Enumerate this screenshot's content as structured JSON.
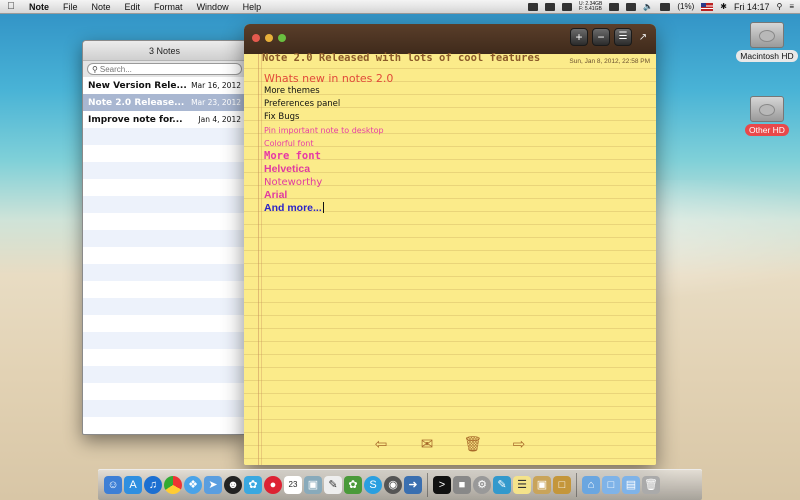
{
  "menubar": {
    "app_name": "Note",
    "menus": [
      "File",
      "Note",
      "Edit",
      "Format",
      "Window",
      "Help"
    ],
    "memory_used": "2.34GB",
    "memory_free": "5.41GB",
    "memory_used_prefix": "U:",
    "memory_free_prefix": "F:",
    "battery": "(1%)",
    "clock": "Fri 14:17"
  },
  "notes_list": {
    "title": "3 Notes",
    "search_placeholder": "Search...",
    "items": [
      {
        "title": "New Version Rele...",
        "date": "Mar 16, 2012"
      },
      {
        "title": "Note 2.0 Release...",
        "date": "Mar 23, 2012",
        "selected": true
      },
      {
        "title": "Improve note for...",
        "date": "Jan 4, 2012"
      }
    ]
  },
  "note": {
    "title": "Note 2.0 Released with lots of cool features",
    "date": "Sun, Jan 8, 2012, 22:58 PM",
    "lines": [
      {
        "text": "Whats new in notes 2.0",
        "style": "head"
      },
      {
        "text": "More themes",
        "style": "black"
      },
      {
        "text": "Preferences panel",
        "style": "black"
      },
      {
        "text": "Fix Bugs",
        "style": "black"
      },
      {
        "text": "Pin important note to desktop",
        "style": "pink-small"
      },
      {
        "text": "Colorful font",
        "style": "pink-small"
      },
      {
        "text": "More font",
        "style": "pink-mono"
      },
      {
        "text": "Helvetica",
        "style": "pink-bold"
      },
      {
        "text": "Noteworthy",
        "style": "pink-reg"
      },
      {
        "text": "Arial",
        "style": "pink-bold"
      },
      {
        "text": "And more...",
        "style": "blue"
      }
    ],
    "toolbar_icons": [
      "add-note-icon",
      "delete-note-icon",
      "list-icon",
      "expand-icon"
    ],
    "bottom_icons": [
      "previous-icon",
      "mail-icon",
      "trash-icon",
      "next-icon"
    ]
  },
  "desktop": {
    "disks": [
      {
        "label": "Macintosh HD"
      },
      {
        "label": "Other HD"
      }
    ]
  },
  "dock": {
    "icons": [
      "finder-icon",
      "app-store-icon",
      "itunes-icon",
      "chrome-icon",
      "safari-icon",
      "mail-send-icon",
      "qq-icon",
      "twitter-icon",
      "bird-icon",
      "calendar-icon",
      "photos-icon",
      "notes-icon",
      "evernote-icon",
      "skype-icon",
      "camera-icon",
      "xcode-icon",
      "terminal-icon",
      "activity-monitor-icon",
      "system-preferences-icon",
      "pen-icon",
      "notepad-icon",
      "box-icon",
      "package-icon",
      "home-icon",
      "folder-icon",
      "documents-folder-icon",
      "trash-icon"
    ],
    "calendar_day": "23"
  },
  "colors": {
    "note_paper": "#fbeb8a",
    "note_header": "#4b3322",
    "selection": "#a9b7d1",
    "heading_red": "#e14a3a",
    "pink": "#e03aa0",
    "blue": "#2a23c8"
  }
}
